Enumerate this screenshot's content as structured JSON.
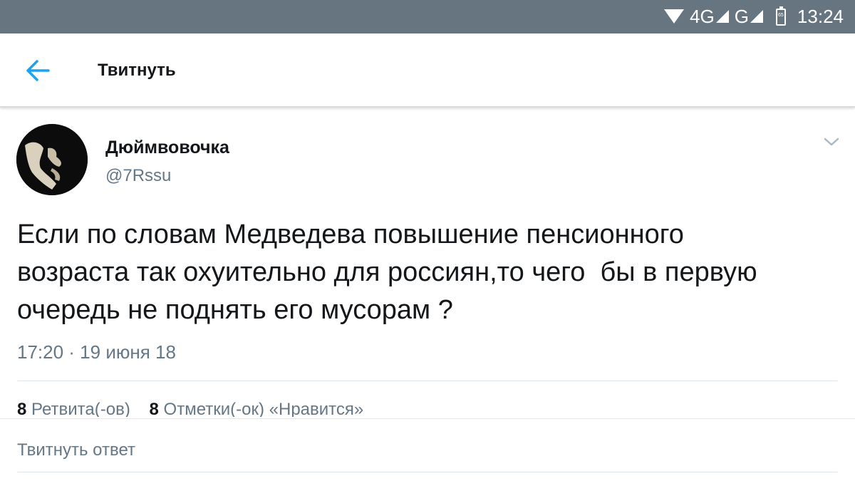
{
  "status_bar": {
    "network_1": "4G",
    "network_2": "G",
    "battery": "65",
    "time": "13:24"
  },
  "header": {
    "title": "Твитнуть",
    "back_icon": "arrow-left-icon"
  },
  "tweet": {
    "author_name": "Дюймвовочка",
    "author_handle": "@7Rssu",
    "text": "Если по словам Медведева повышение пенсионного\nвозраста так охуительно для россиян,то чего  бы в первую\nочередь не поднять его мусорам ?",
    "timestamp": "17:20 · 19 июня 18",
    "retweets_count": "8",
    "retweets_label": "Ретвита(-ов)",
    "likes_count": "8",
    "likes_label": "Отметки(-ок) «Нравится»"
  },
  "reply": {
    "placeholder": "Твитнуть ответ"
  },
  "colors": {
    "status_bar": "#66757f",
    "accent": "#1da1f2",
    "muted_text": "#657786",
    "primary_text": "#14171a"
  }
}
